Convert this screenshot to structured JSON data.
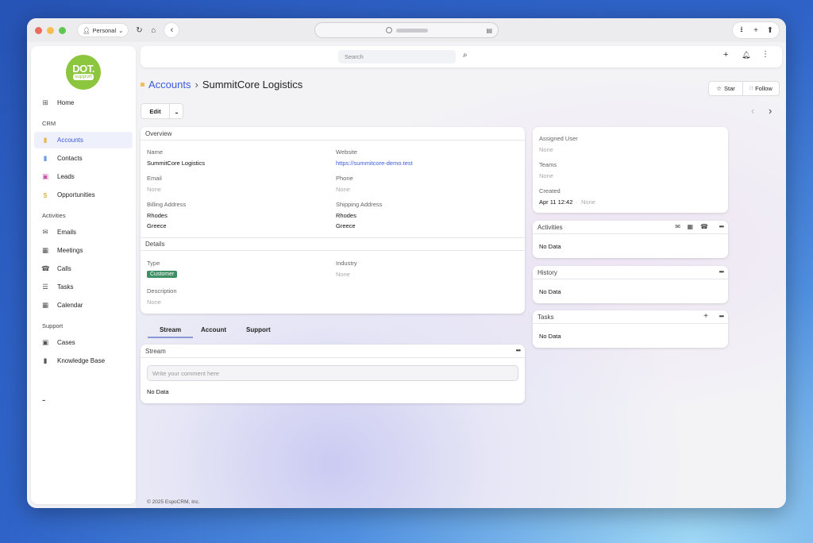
{
  "browser": {
    "profile_label": "Personal",
    "colors": {
      "red": "#ed6a5e",
      "yellow": "#f5bf4f",
      "green": "#61c554"
    }
  },
  "logo": {
    "line1": "DOT.",
    "line2": "support"
  },
  "sidebar": {
    "home": "Home",
    "crm_section": "CRM",
    "items_crm": [
      {
        "label": "Accounts",
        "icon": "bookmark-icon"
      },
      {
        "label": "Contacts",
        "icon": "contact-card-icon"
      },
      {
        "label": "Leads",
        "icon": "id-card-icon"
      },
      {
        "label": "Opportunities",
        "icon": "dollar-icon"
      }
    ],
    "activities_section": "Activities",
    "items_activities": [
      {
        "label": "Emails",
        "icon": "envelope-icon"
      },
      {
        "label": "Meetings",
        "icon": "calendar-check-icon"
      },
      {
        "label": "Calls",
        "icon": "phone-icon"
      },
      {
        "label": "Tasks",
        "icon": "tasks-icon"
      },
      {
        "label": "Calendar",
        "icon": "calendar-icon"
      }
    ],
    "support_section": "Support",
    "items_support": [
      {
        "label": "Cases",
        "icon": "briefcase-icon"
      },
      {
        "label": "Knowledge Base",
        "icon": "book-icon"
      }
    ],
    "more": "..."
  },
  "topbar": {
    "search_placeholder": "Search"
  },
  "breadcrumb": {
    "parent": "Accounts",
    "separator": "›",
    "current": "SummitCore Logistics"
  },
  "actions": {
    "edit": "Edit",
    "more": "...",
    "star": "Star",
    "follow": "Follow"
  },
  "overview": {
    "title": "Overview",
    "name_label": "Name",
    "name": "SummitCore Logistics",
    "website_label": "Website",
    "website": "https://summitcore-demo.test",
    "email_label": "Email",
    "email": "None",
    "phone_label": "Phone",
    "phone": "None",
    "billing_label": "Billing Address",
    "billing_city": "Rhodes",
    "billing_country": "Greece",
    "shipping_label": "Shipping Address",
    "shipping_city": "Rhodes",
    "shipping_country": "Greece"
  },
  "details": {
    "title": "Details",
    "type_label": "Type",
    "type": "Customer",
    "industry_label": "Industry",
    "industry": "None",
    "description_label": "Description",
    "description": "None"
  },
  "tabs": [
    "Stream",
    "Account",
    "Support"
  ],
  "stream": {
    "title": "Stream",
    "comment_placeholder": "Write your comment here",
    "empty": "No Data"
  },
  "side": {
    "assigned_label": "Assigned User",
    "assigned": "None",
    "teams_label": "Teams",
    "teams": "None",
    "created_label": "Created",
    "created_date": "Apr 11 12:42",
    "created_sep": "·",
    "created_by": "None"
  },
  "activities": {
    "title": "Activities",
    "empty": "No Data"
  },
  "history": {
    "title": "History",
    "empty": "No Data"
  },
  "tasks": {
    "title": "Tasks",
    "empty": "No Data"
  },
  "footer": "© 2025 EspoCRM, Inc."
}
